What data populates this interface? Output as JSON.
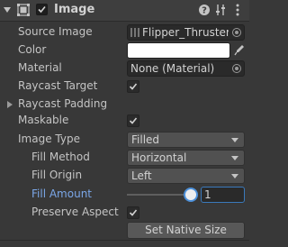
{
  "header": {
    "title": "Image",
    "enabled": true,
    "icons": [
      "foldout-arrow-icon",
      "image-component-icon",
      "help-icon",
      "presets-icon",
      "more-options-icon"
    ]
  },
  "properties": {
    "source_image": {
      "label": "Source Image",
      "value": "Flipper_Thruster_I"
    },
    "color": {
      "label": "Color",
      "value": "#ffffff"
    },
    "material": {
      "label": "Material",
      "value": "None (Material)"
    },
    "raycast_target": {
      "label": "Raycast Target",
      "checked": true
    },
    "raycast_padding": {
      "label": "Raycast Padding",
      "expanded": false
    },
    "maskable": {
      "label": "Maskable",
      "checked": true
    },
    "image_type": {
      "label": "Image Type",
      "value": "Filled"
    },
    "fill_method": {
      "label": "Fill Method",
      "value": "Horizontal"
    },
    "fill_origin": {
      "label": "Fill Origin",
      "value": "Left"
    },
    "fill_amount": {
      "label": "Fill Amount",
      "value": "1",
      "slider_fraction": 1.0
    },
    "preserve_aspect": {
      "label": "Preserve Aspect",
      "checked": true
    },
    "set_native_size": {
      "label": "Set Native Size"
    }
  },
  "colors": {
    "accent": "#4d90d9",
    "label_highlight": "#7ba7e8",
    "background": "#383838"
  }
}
